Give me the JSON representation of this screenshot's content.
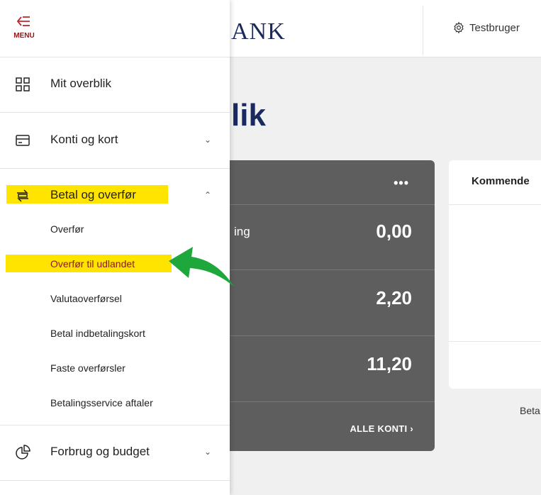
{
  "header": {
    "logo_text": "ANK",
    "user_name": "Testbruger"
  },
  "page": {
    "title": "lik"
  },
  "accounts_card": {
    "more_label": "•••",
    "rows": [
      {
        "label": "ing",
        "amount": "0,00"
      },
      {
        "label": "",
        "amount": "2,20"
      },
      {
        "label": "",
        "amount": "11,20"
      }
    ],
    "all_accounts_label": "ALLE KONTI ›"
  },
  "upcoming_card": {
    "title": "Kommende"
  },
  "footer_partial_text": "Beta",
  "sidebar": {
    "menu_label": "MENU",
    "items": [
      {
        "label": "Mit overblik",
        "icon": "grid-icon"
      },
      {
        "label": "Konti og kort",
        "icon": "card-icon",
        "chevron": "⌄"
      },
      {
        "label": "Betal og overfør",
        "icon": "transfer-icon",
        "chevron": "⌃"
      },
      {
        "label": "Forbrug og budget",
        "icon": "pie-chart-icon",
        "chevron": "⌄"
      }
    ],
    "sub_items": [
      "Overfør",
      "Overfør til udlandet",
      "Valutaoverførsel",
      "Betal indbetalingskort",
      "Faste overførsler",
      "Betalingsservice aftaler"
    ]
  },
  "colors": {
    "highlight": "#ffe400",
    "accent_red": "#8a1a1a",
    "arrow_green": "#1ea83c",
    "card_bg": "#5e5e5e",
    "brand_navy": "#1a2a5e"
  }
}
